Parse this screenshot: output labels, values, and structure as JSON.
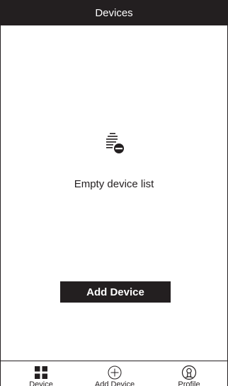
{
  "header": {
    "title": "Devices"
  },
  "empty_state": {
    "icon": "empty-list-icon",
    "message": "Empty device list"
  },
  "actions": {
    "add_device_label": "Add Device"
  },
  "tabbar": {
    "tabs": [
      {
        "label": "Device",
        "icon": "grid-icon"
      },
      {
        "label": "Add Device",
        "icon": "add-circle-icon"
      },
      {
        "label": "Profile",
        "icon": "profile-icon"
      }
    ]
  },
  "colors": {
    "primary": "#231f20",
    "background": "#ffffff",
    "text_on_primary": "#ffffff"
  }
}
